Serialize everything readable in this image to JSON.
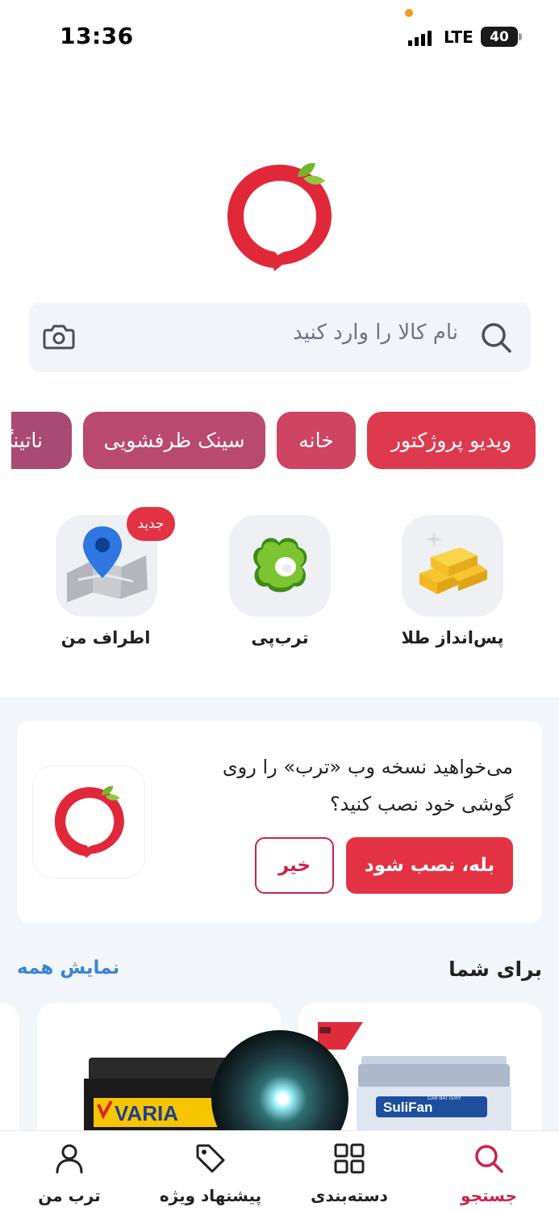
{
  "status_bar": {
    "time": "13:36",
    "network": "LTE",
    "battery": "40"
  },
  "search": {
    "placeholder": "نام کالا را وارد کنید"
  },
  "chips": [
    "ویدیو پروژکتور",
    "خانه",
    "سینک ظرفشویی",
    "ناتینگ"
  ],
  "chip_colors": [
    "#de3a4e",
    "#cd4562",
    "#b9496e",
    "#a84a72"
  ],
  "services": [
    {
      "label": "پس‌انداز طلا",
      "icon": "gold-bars-icon"
    },
    {
      "label": "ترب‌پی",
      "icon": "torob-pay-icon"
    },
    {
      "label": "اطراف من",
      "icon": "map-pin-icon",
      "badge": "جدید"
    }
  ],
  "pwa_prompt": {
    "text": "می‌خواهید نسخه وب «ترب» را روی گوشی خود نصب کنید؟",
    "yes_label": "بله، نصب شود",
    "no_label": "خیر"
  },
  "for_you": {
    "title": "برای شما",
    "show_all": "نمایش همه"
  },
  "products": [
    {
      "brand_label": "SuliFan",
      "sublabel": "CAR BATTERY"
    },
    {
      "brand_label": "VARIA"
    }
  ],
  "bottom_nav": [
    {
      "label": "جستجو",
      "icon": "search-icon",
      "active": true
    },
    {
      "label": "دسته‌بندی",
      "icon": "grid-icon",
      "active": false
    },
    {
      "label": "پیشنهاد ویژه",
      "icon": "tag-icon",
      "active": false
    },
    {
      "label": "ترب من",
      "icon": "user-icon",
      "active": false
    }
  ],
  "colors": {
    "brand_red": "#e23244",
    "link_blue": "#3a84d6",
    "active_nav": "#c8244a"
  }
}
